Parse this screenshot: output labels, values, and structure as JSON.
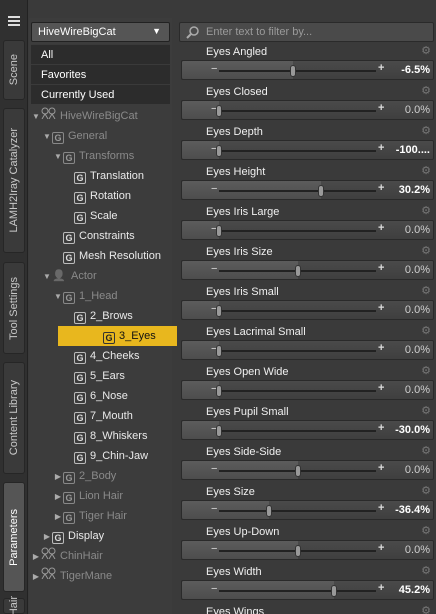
{
  "side_tabs": [
    {
      "label": "Scene",
      "active": false
    },
    {
      "label": "LAMH2Iray Catalyzer",
      "active": false
    },
    {
      "label": "Tool Settings",
      "active": false
    },
    {
      "label": "Content Library",
      "active": false
    },
    {
      "label": "Parameters",
      "active": true
    },
    {
      "label": "Hair",
      "active": false
    }
  ],
  "tree": {
    "dropdown_value": "HiveWireBigCat",
    "filters": [
      "All",
      "Favorites",
      "Currently Used"
    ],
    "nodes": [
      {
        "label": "HiveWireBigCat",
        "icon": "figure-icon",
        "dim": true
      },
      {
        "label": "General",
        "icon": "group-icon",
        "dim": true
      },
      {
        "label": "Transforms",
        "icon": "group-icon",
        "dim": true
      },
      {
        "label": "Translation",
        "icon": "group-icon",
        "dim": false
      },
      {
        "label": "Rotation",
        "icon": "group-icon",
        "dim": false
      },
      {
        "label": "Scale",
        "icon": "group-icon",
        "dim": false
      },
      {
        "label": "Constraints",
        "icon": "group-icon",
        "dim": false
      },
      {
        "label": "Mesh Resolution",
        "icon": "group-icon",
        "dim": false
      },
      {
        "label": "Actor",
        "icon": "actor-icon",
        "dim": true
      },
      {
        "label": "1_Head",
        "icon": "group-icon",
        "dim": true
      },
      {
        "label": "2_Brows",
        "icon": "group-icon",
        "dim": false
      },
      {
        "label": "3_Eyes",
        "icon": "group-icon",
        "dim": false,
        "selected": true
      },
      {
        "label": "4_Cheeks",
        "icon": "group-icon",
        "dim": false
      },
      {
        "label": "5_Ears",
        "icon": "group-icon",
        "dim": false
      },
      {
        "label": "6_Nose",
        "icon": "group-icon",
        "dim": false
      },
      {
        "label": "7_Mouth",
        "icon": "group-icon",
        "dim": false
      },
      {
        "label": "8_Whiskers",
        "icon": "group-icon",
        "dim": false
      },
      {
        "label": "9_Chin-Jaw",
        "icon": "group-icon",
        "dim": false
      },
      {
        "label": "2_Body",
        "icon": "group-icon",
        "dim": true
      },
      {
        "label": "Lion Hair",
        "icon": "group-icon",
        "dim": true
      },
      {
        "label": "Tiger Hair",
        "icon": "group-icon",
        "dim": true
      },
      {
        "label": "Display",
        "icon": "group-icon",
        "dim": false
      },
      {
        "label": "ChinHair",
        "icon": "figure-icon",
        "dim": true
      },
      {
        "label": "TigerMane",
        "icon": "figure-icon",
        "dim": true
      }
    ]
  },
  "params": {
    "filter_placeholder": "Enter text to filter by...",
    "items": [
      {
        "label": "Eyes Angled",
        "value": "-6.5%",
        "pos": 0.47,
        "changed": true
      },
      {
        "label": "Eyes Closed",
        "value": "0.0%",
        "pos": 0.0,
        "changed": false
      },
      {
        "label": "Eyes Depth",
        "value": "-100....",
        "pos": 0.0,
        "changed": true
      },
      {
        "label": "Eyes Height",
        "value": "30.2%",
        "pos": 0.65,
        "changed": true
      },
      {
        "label": "Eyes Iris Large",
        "value": "0.0%",
        "pos": 0.0,
        "changed": false
      },
      {
        "label": "Eyes Iris Size",
        "value": "0.0%",
        "pos": 0.5,
        "changed": false
      },
      {
        "label": "Eyes Iris Small",
        "value": "0.0%",
        "pos": 0.0,
        "changed": false
      },
      {
        "label": "Eyes Lacrimal Small",
        "value": "0.0%",
        "pos": 0.0,
        "changed": false
      },
      {
        "label": "Eyes Open Wide",
        "value": "0.0%",
        "pos": 0.0,
        "changed": false
      },
      {
        "label": "Eyes Pupil Small",
        "value": "-30.0%",
        "pos": 0.0,
        "changed": true
      },
      {
        "label": "Eyes Side-Side",
        "value": "0.0%",
        "pos": 0.5,
        "changed": false
      },
      {
        "label": "Eyes Size",
        "value": "-36.4%",
        "pos": 0.32,
        "changed": true
      },
      {
        "label": "Eyes Up-Down",
        "value": "0.0%",
        "pos": 0.5,
        "changed": false
      },
      {
        "label": "Eyes Width",
        "value": "45.2%",
        "pos": 0.73,
        "changed": true
      },
      {
        "label": "Eyes Wings",
        "value": "",
        "pos": 0.5,
        "changed": false
      }
    ]
  }
}
